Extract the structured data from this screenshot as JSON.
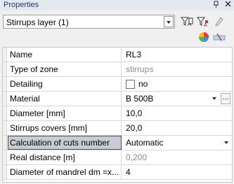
{
  "panel": {
    "title": "Properties",
    "pin_icon": "pin-icon",
    "close_icon": "close-icon"
  },
  "layer_select": {
    "value": "Stirrups layer (1)"
  },
  "toolbar": {
    "icons": [
      "filter-icon",
      "filter-edit-icon",
      "pencil-icon",
      "color-wheel-icon",
      "clear-icon"
    ]
  },
  "properties": [
    {
      "name": "Name",
      "value": "RL3",
      "kind": "text"
    },
    {
      "name": "Type of zone",
      "value": "stirrups",
      "kind": "readonly"
    },
    {
      "name": "Detailing",
      "value": "no",
      "kind": "checkbox"
    },
    {
      "name": "Material",
      "value": "B 500B",
      "kind": "dropdown-ellipsis"
    },
    {
      "name": "Diameter [mm]",
      "value": "10,0",
      "kind": "text"
    },
    {
      "name": "Stirrups covers [mm]",
      "value": "20,0",
      "kind": "text"
    },
    {
      "name": "Calculation of cuts number",
      "value": "Automatic",
      "kind": "dropdown",
      "selected": true
    },
    {
      "name": "Real distance [m]",
      "value": "0,200",
      "kind": "readonly"
    },
    {
      "name": "Diameter of mandrel dm =x...",
      "value": "4",
      "kind": "text"
    }
  ],
  "colors": {
    "selected_row": "#c8cdd5",
    "readonly_text": "#8c8c8c",
    "title_text": "#1a3a6b"
  }
}
